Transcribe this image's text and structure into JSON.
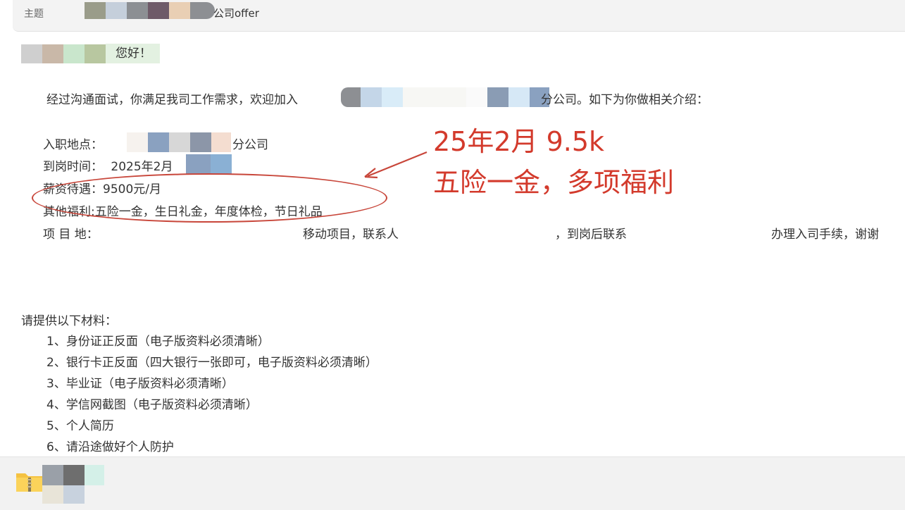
{
  "subject": {
    "label": "主题",
    "title": "公司offer"
  },
  "greeting": "您好！",
  "intro": {
    "before": "经过沟通面试，你满足我司工作需求，欢迎加入",
    "after": "分公司。如下为你做相关介绍："
  },
  "details": {
    "location": {
      "label": "入职地点：",
      "value": "分公司"
    },
    "start_date": {
      "label": "到岗时间：",
      "value": "2025年2月"
    },
    "salary": {
      "label": "薪资待遇：",
      "value": "9500元/月"
    },
    "benefits": {
      "label": "其他福利:",
      "value": "五险一金，生日礼金，年度体检，节日礼品"
    },
    "project": {
      "label": "项 目 地：",
      "part1": "移动项目，联系人",
      "part2": "，到岗后联系",
      "part3": "办理入司手续，谢谢"
    }
  },
  "annotation": {
    "line1": "25年2月  9.5k",
    "line2": "五险一金，多项福利",
    "color": "#d33a2c"
  },
  "materials": {
    "title": "请提供以下材料：",
    "items": [
      "1、身份证正反面（电子版资料必须清晰）",
      "2、银行卡正反面（四大银行一张即可，电子版资料必须清晰）",
      "3、毕业证（电子版资料必须清晰）",
      "4、学信网截图（电子版资料必须清晰）",
      "5、个人简历",
      "6、请沿途做好个人防护"
    ]
  },
  "attachment": {
    "icon": "zip-folder-icon"
  }
}
